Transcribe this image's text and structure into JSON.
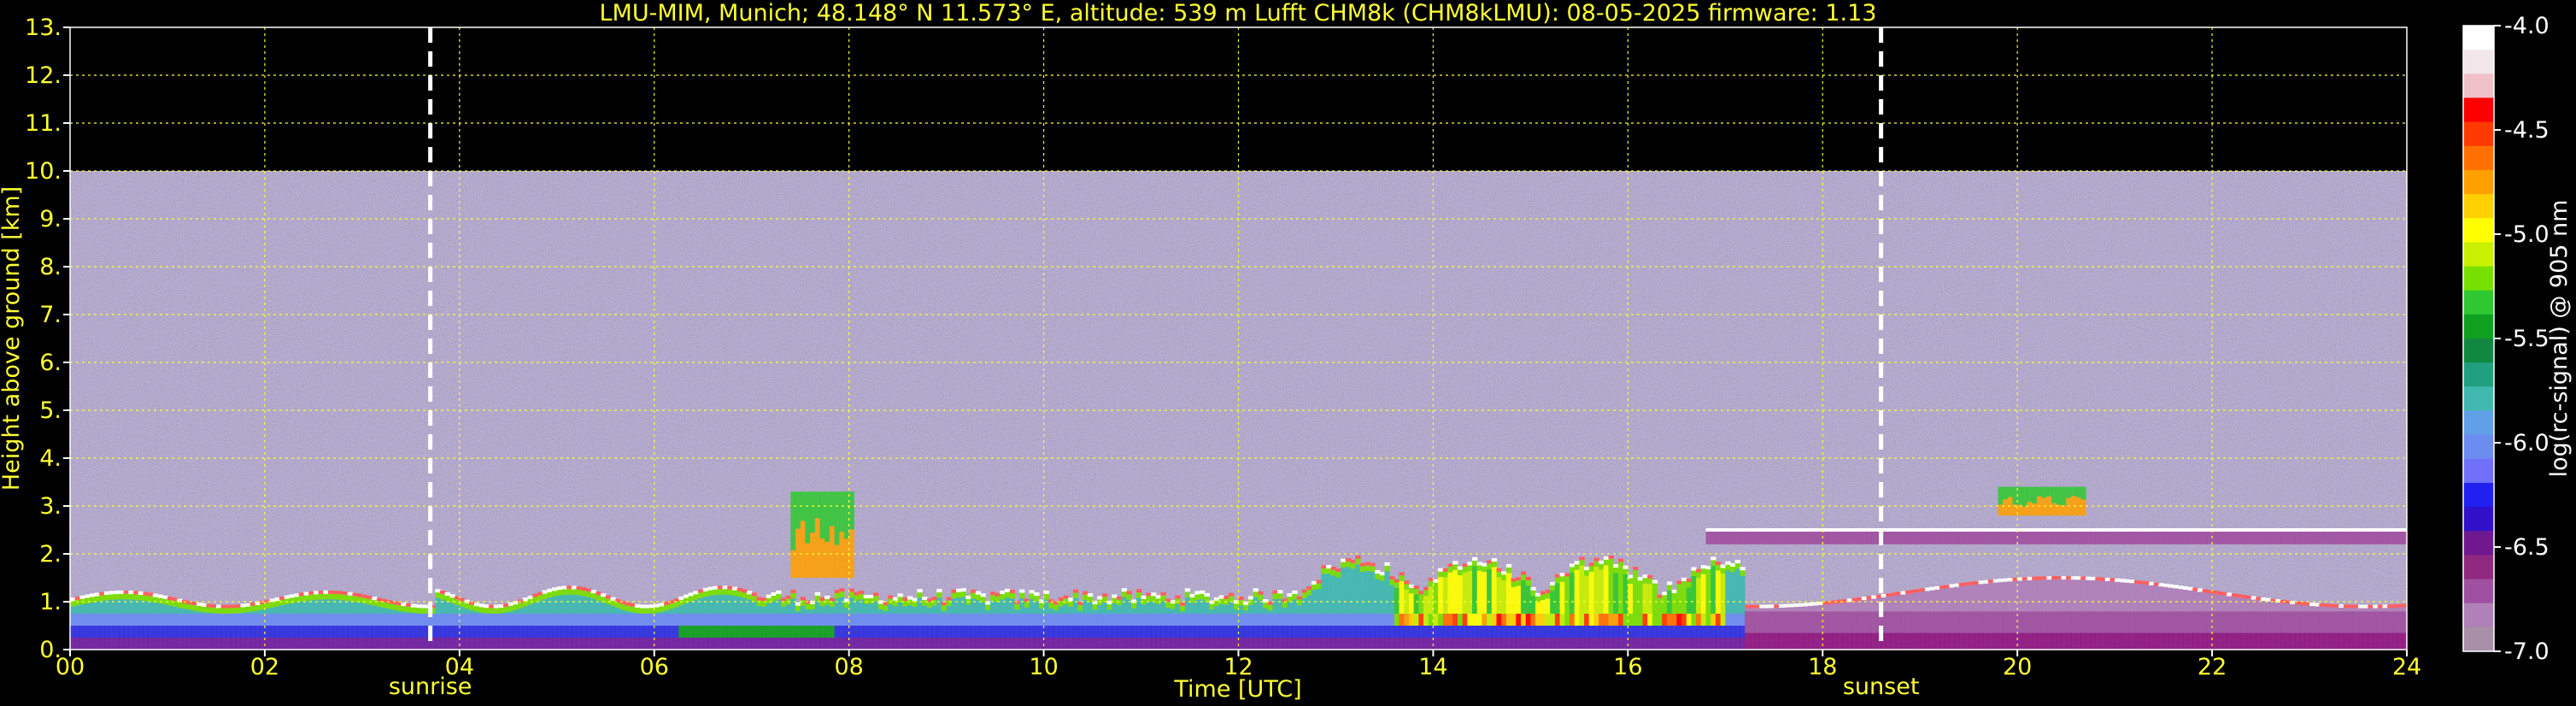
{
  "chart_data": {
    "type": "heatmap",
    "title": "LMU-MIM, Munich; 48.148° N 11.573° E, altitude: 539 m    Lufft CHM8k (CHM8kLMU): 08-05-2025    firmware: 1.13",
    "xlabel": "Time [UTC]",
    "ylabel": "Height above ground [km]",
    "xlim": [
      0,
      24
    ],
    "ylim": [
      0,
      13
    ],
    "x_ticks": [
      "00",
      "02",
      "04",
      "06",
      "08",
      "10",
      "12",
      "14",
      "16",
      "18",
      "20",
      "22",
      "24"
    ],
    "y_ticks": [
      "0.",
      "1.",
      "2.",
      "3.",
      "4.",
      "5.",
      "6.",
      "7.",
      "8.",
      "9.",
      "10.",
      "11.",
      "12.",
      "13."
    ],
    "grid": true,
    "sunrise": {
      "time": 3.7,
      "label": "sunrise"
    },
    "sunset": {
      "time": 18.6,
      "label": "sunset"
    },
    "data_top_km": 10,
    "colorbar": {
      "label": "log(rc-signal) @ 905 nm",
      "range": [
        -7.0,
        -4.0
      ],
      "ticks": [
        "-4.0",
        "-4.5",
        "-5.0",
        "-5.5",
        "-6.0",
        "-6.5",
        "-7.0"
      ],
      "colors": [
        "#ffffff",
        "#f2e6ea",
        "#f0c0c8",
        "#ff0000",
        "#ff3a00",
        "#ff7000",
        "#ffa000",
        "#ffd000",
        "#ffff00",
        "#c8f000",
        "#78e000",
        "#30c830",
        "#10a020",
        "#108840",
        "#20a080",
        "#40b8b0",
        "#60a0e8",
        "#6c8cf0",
        "#7070f8",
        "#2020f0",
        "#3010c8",
        "#701890",
        "#902880",
        "#a050a0",
        "#b080b8",
        "#a890a8"
      ]
    },
    "features": [
      {
        "name": "boundary-layer",
        "t_start": 0,
        "t_end": 17.2,
        "height_km": [
          0.0,
          1.1
        ]
      },
      {
        "name": "elevated-aerosol-layer",
        "t_start": 16.8,
        "t_end": 24,
        "height_km": [
          2.2,
          2.5
        ]
      },
      {
        "name": "residual-layer-night",
        "t_start": 17.2,
        "t_end": 24,
        "height_km": [
          0.0,
          1.6
        ]
      },
      {
        "name": "cloud-patch",
        "t_start": 7.4,
        "t_end": 8.0,
        "height_km": [
          1.5,
          3.3
        ]
      },
      {
        "name": "cloud-patch",
        "t_start": 19.8,
        "t_end": 20.7,
        "height_km": [
          2.8,
          3.4
        ]
      }
    ]
  }
}
